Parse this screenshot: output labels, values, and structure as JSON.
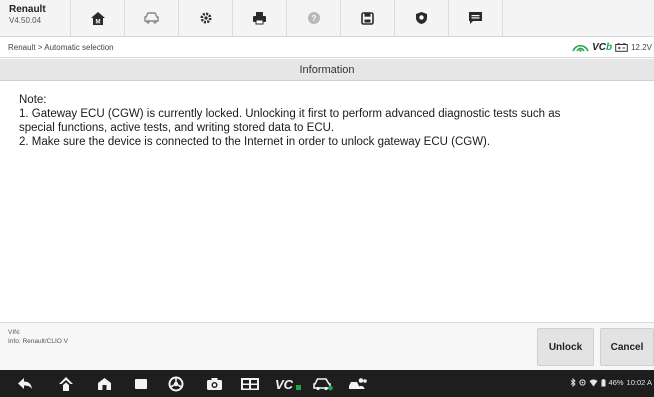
{
  "app": {
    "name": "Renault",
    "version": "V4.50.04"
  },
  "toolbar": {
    "buttons": [
      {
        "name": "home-icon"
      },
      {
        "name": "vehicle-swap-icon"
      },
      {
        "name": "settings-icon"
      },
      {
        "name": "print-icon"
      },
      {
        "name": "help-icon"
      },
      {
        "name": "save-icon"
      },
      {
        "name": "data-logging-icon"
      },
      {
        "name": "chat-icon"
      }
    ]
  },
  "breadcrumb": "Renault > Automatic selection",
  "status": {
    "vci_label": "VC",
    "vci_suffix": "b",
    "battery": "12.2V"
  },
  "page": {
    "title": "Information"
  },
  "note": {
    "heading": "Note:",
    "line1": "1. Gateway ECU (CGW) is currently locked. Unlocking it first to perform advanced diagnostic tests such as",
    "line2": "special functions, active tests, and writing stored data to ECU.",
    "line3": "2. Make sure the device is connected to the Internet in order to unlock gateway ECU (CGW)."
  },
  "footer": {
    "vin_label": "VIN:",
    "info_label": "Info: Renault/CLIO V",
    "unlock_label": "Unlock",
    "cancel_label": "Cancel"
  },
  "system": {
    "battery_pct": "46%",
    "time": "10:02 A"
  }
}
